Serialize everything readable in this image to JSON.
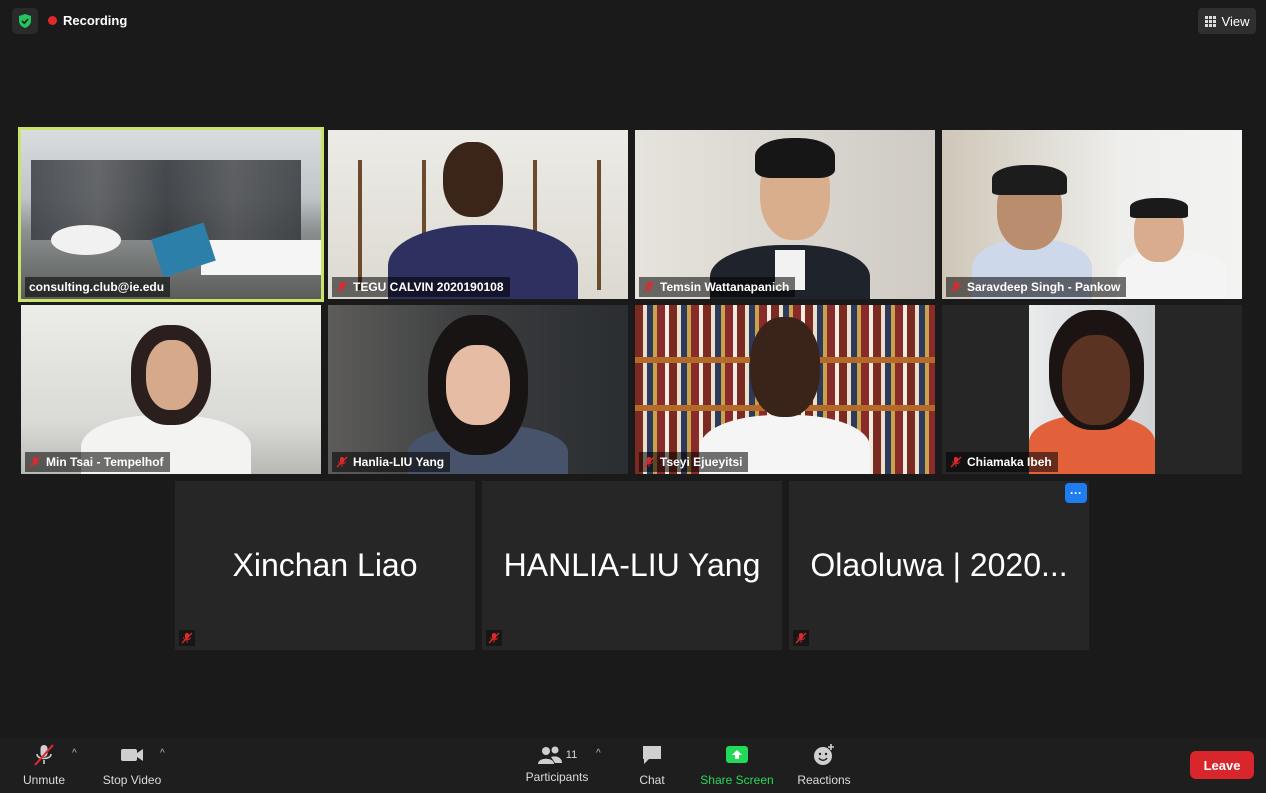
{
  "top": {
    "recording_label": "Recording",
    "view_label": "View"
  },
  "tiles": [
    {
      "name": "consulting.club@ie.edu"
    },
    {
      "name": "TEGU CALVIN 2020190108"
    },
    {
      "name": "Temsin Wattanapanich"
    },
    {
      "name": "Saravdeep Singh - Pankow"
    },
    {
      "name": "Min Tsai - Tempelhof"
    },
    {
      "name": "Hanlia-LIU Yang"
    },
    {
      "name": "Tseyi Ejueyitsi"
    },
    {
      "name": "Chiamaka Ibeh"
    },
    {
      "name": "Xinchan Liao"
    },
    {
      "name": "HANLIA-LIU Yang"
    },
    {
      "name": "Olaoluwa | 2020..."
    }
  ],
  "more_label": "···",
  "toolbar": {
    "unmute": "Unmute",
    "stop_video": "Stop Video",
    "participants": "Participants",
    "participants_count": "11",
    "chat": "Chat",
    "share_screen": "Share Screen",
    "reactions": "Reactions",
    "leave": "Leave"
  },
  "colors": {
    "active_speaker": "#c9e36b",
    "recording": "#e0282d",
    "share": "#23d959",
    "leave": "#d8262c",
    "more": "#1e7ef0"
  },
  "icons": [
    "shield-icon",
    "grid-icon",
    "mic-off-icon",
    "video-icon",
    "participants-icon",
    "chat-icon",
    "share-screen-icon",
    "reactions-icon"
  ]
}
